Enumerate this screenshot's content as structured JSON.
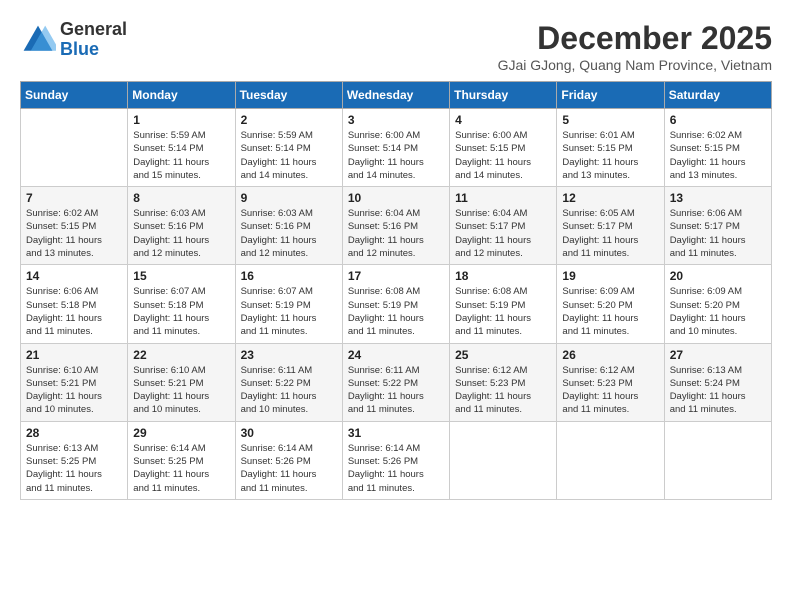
{
  "logo": {
    "general": "General",
    "blue": "Blue"
  },
  "title": "December 2025",
  "location": "GJai GJong, Quang Nam Province, Vietnam",
  "weekdays": [
    "Sunday",
    "Monday",
    "Tuesday",
    "Wednesday",
    "Thursday",
    "Friday",
    "Saturday"
  ],
  "weeks": [
    [
      {
        "day": "",
        "info": ""
      },
      {
        "day": "1",
        "info": "Sunrise: 5:59 AM\nSunset: 5:14 PM\nDaylight: 11 hours\nand 15 minutes."
      },
      {
        "day": "2",
        "info": "Sunrise: 5:59 AM\nSunset: 5:14 PM\nDaylight: 11 hours\nand 14 minutes."
      },
      {
        "day": "3",
        "info": "Sunrise: 6:00 AM\nSunset: 5:14 PM\nDaylight: 11 hours\nand 14 minutes."
      },
      {
        "day": "4",
        "info": "Sunrise: 6:00 AM\nSunset: 5:15 PM\nDaylight: 11 hours\nand 14 minutes."
      },
      {
        "day": "5",
        "info": "Sunrise: 6:01 AM\nSunset: 5:15 PM\nDaylight: 11 hours\nand 13 minutes."
      },
      {
        "day": "6",
        "info": "Sunrise: 6:02 AM\nSunset: 5:15 PM\nDaylight: 11 hours\nand 13 minutes."
      }
    ],
    [
      {
        "day": "7",
        "info": "Sunrise: 6:02 AM\nSunset: 5:15 PM\nDaylight: 11 hours\nand 13 minutes."
      },
      {
        "day": "8",
        "info": "Sunrise: 6:03 AM\nSunset: 5:16 PM\nDaylight: 11 hours\nand 12 minutes."
      },
      {
        "day": "9",
        "info": "Sunrise: 6:03 AM\nSunset: 5:16 PM\nDaylight: 11 hours\nand 12 minutes."
      },
      {
        "day": "10",
        "info": "Sunrise: 6:04 AM\nSunset: 5:16 PM\nDaylight: 11 hours\nand 12 minutes."
      },
      {
        "day": "11",
        "info": "Sunrise: 6:04 AM\nSunset: 5:17 PM\nDaylight: 11 hours\nand 12 minutes."
      },
      {
        "day": "12",
        "info": "Sunrise: 6:05 AM\nSunset: 5:17 PM\nDaylight: 11 hours\nand 11 minutes."
      },
      {
        "day": "13",
        "info": "Sunrise: 6:06 AM\nSunset: 5:17 PM\nDaylight: 11 hours\nand 11 minutes."
      }
    ],
    [
      {
        "day": "14",
        "info": "Sunrise: 6:06 AM\nSunset: 5:18 PM\nDaylight: 11 hours\nand 11 minutes."
      },
      {
        "day": "15",
        "info": "Sunrise: 6:07 AM\nSunset: 5:18 PM\nDaylight: 11 hours\nand 11 minutes."
      },
      {
        "day": "16",
        "info": "Sunrise: 6:07 AM\nSunset: 5:19 PM\nDaylight: 11 hours\nand 11 minutes."
      },
      {
        "day": "17",
        "info": "Sunrise: 6:08 AM\nSunset: 5:19 PM\nDaylight: 11 hours\nand 11 minutes."
      },
      {
        "day": "18",
        "info": "Sunrise: 6:08 AM\nSunset: 5:19 PM\nDaylight: 11 hours\nand 11 minutes."
      },
      {
        "day": "19",
        "info": "Sunrise: 6:09 AM\nSunset: 5:20 PM\nDaylight: 11 hours\nand 11 minutes."
      },
      {
        "day": "20",
        "info": "Sunrise: 6:09 AM\nSunset: 5:20 PM\nDaylight: 11 hours\nand 10 minutes."
      }
    ],
    [
      {
        "day": "21",
        "info": "Sunrise: 6:10 AM\nSunset: 5:21 PM\nDaylight: 11 hours\nand 10 minutes."
      },
      {
        "day": "22",
        "info": "Sunrise: 6:10 AM\nSunset: 5:21 PM\nDaylight: 11 hours\nand 10 minutes."
      },
      {
        "day": "23",
        "info": "Sunrise: 6:11 AM\nSunset: 5:22 PM\nDaylight: 11 hours\nand 10 minutes."
      },
      {
        "day": "24",
        "info": "Sunrise: 6:11 AM\nSunset: 5:22 PM\nDaylight: 11 hours\nand 11 minutes."
      },
      {
        "day": "25",
        "info": "Sunrise: 6:12 AM\nSunset: 5:23 PM\nDaylight: 11 hours\nand 11 minutes."
      },
      {
        "day": "26",
        "info": "Sunrise: 6:12 AM\nSunset: 5:23 PM\nDaylight: 11 hours\nand 11 minutes."
      },
      {
        "day": "27",
        "info": "Sunrise: 6:13 AM\nSunset: 5:24 PM\nDaylight: 11 hours\nand 11 minutes."
      }
    ],
    [
      {
        "day": "28",
        "info": "Sunrise: 6:13 AM\nSunset: 5:25 PM\nDaylight: 11 hours\nand 11 minutes."
      },
      {
        "day": "29",
        "info": "Sunrise: 6:14 AM\nSunset: 5:25 PM\nDaylight: 11 hours\nand 11 minutes."
      },
      {
        "day": "30",
        "info": "Sunrise: 6:14 AM\nSunset: 5:26 PM\nDaylight: 11 hours\nand 11 minutes."
      },
      {
        "day": "31",
        "info": "Sunrise: 6:14 AM\nSunset: 5:26 PM\nDaylight: 11 hours\nand 11 minutes."
      },
      {
        "day": "",
        "info": ""
      },
      {
        "day": "",
        "info": ""
      },
      {
        "day": "",
        "info": ""
      }
    ]
  ]
}
